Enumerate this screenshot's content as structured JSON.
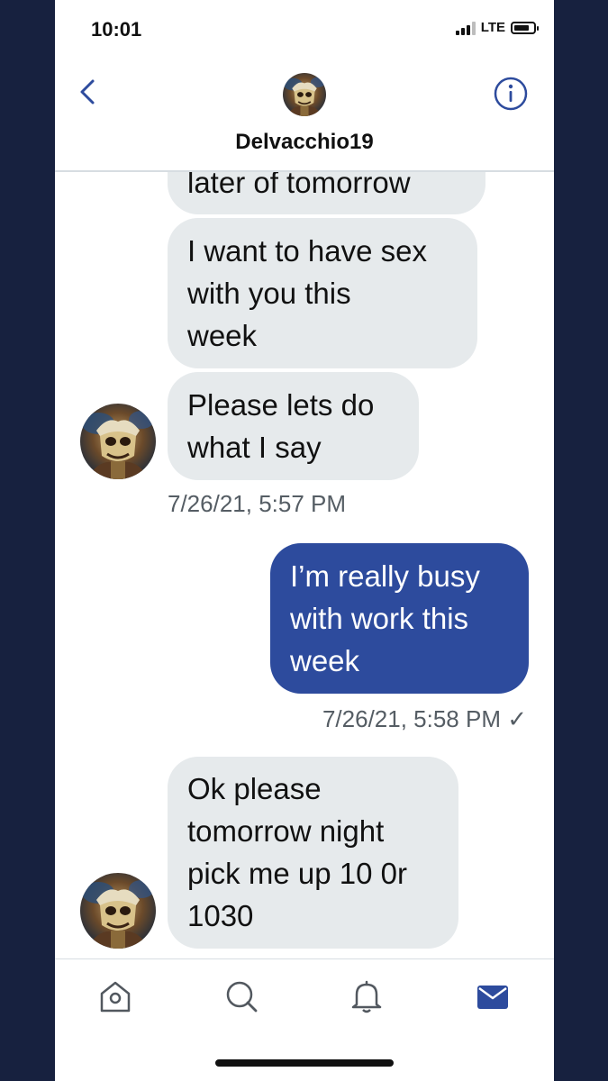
{
  "status_bar": {
    "time": "10:01",
    "network": "LTE"
  },
  "header": {
    "username": "Delvacchio19",
    "back_icon": "chevron-left-icon",
    "info_icon": "info-circle-icon"
  },
  "messages": [
    {
      "direction": "in",
      "text": "later of tomorrow"
    },
    {
      "direction": "in",
      "text": "I want to have sex\nwith you this\nweek"
    },
    {
      "direction": "in",
      "text": "Please lets do\nwhat I say"
    },
    {
      "timestamp": "7/26/21, 5:57 PM"
    },
    {
      "direction": "out",
      "text": "I’m really busy\nwith work this\nweek"
    },
    {
      "timestamp": "7/26/21, 5:58 PM ✓"
    },
    {
      "direction": "in",
      "text": "Ok please\ntomorrow night\npick me up 10 0r\n1030"
    }
  ],
  "tab_bar": {
    "items": [
      "home-icon",
      "search-icon",
      "notifications-bell-icon",
      "messages-envelope-icon"
    ],
    "active": "messages-envelope-icon"
  },
  "colors": {
    "accent": "#2d4b9d",
    "incoming_bubble": "#e6eaec",
    "outer_background": "#17213f"
  }
}
